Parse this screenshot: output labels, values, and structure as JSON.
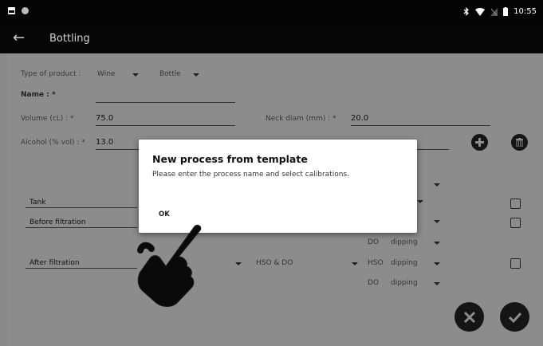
{
  "status": {
    "time": "10:55"
  },
  "appbar": {
    "title": "Bottling"
  },
  "form": {
    "type_label": "Type of product :",
    "type_value": "Wine",
    "container_value": "Bottle",
    "name_label": "Name : *",
    "name_value": "",
    "volume_label": "Volume (cL) : *",
    "volume_value": "75.0",
    "neck_label": "Neck diam (mm) : *",
    "neck_value": "20.0",
    "alcohol_label": "Alcohol (% vol) : *",
    "alcohol_value": "13.0"
  },
  "process_rows": [
    {
      "name": "Tank"
    },
    {
      "name": "Before filtration"
    },
    {
      "name": "After filtration",
      "cal_a": "HSO & DO",
      "cal_b": "HSO",
      "mode_b": "dipping"
    }
  ],
  "extra_options": {
    "do_label_1": "DO",
    "dipping_1": "dipping",
    "do_label_2": "DO",
    "dipping_2": "dipping"
  },
  "dialog": {
    "title": "New process from template",
    "message": "Please enter the process name and select calibrations.",
    "ok_label": "OK"
  },
  "colors": {
    "overlay": "#8c8c8c",
    "bar": "#060606",
    "dialog": "#ffffff"
  }
}
